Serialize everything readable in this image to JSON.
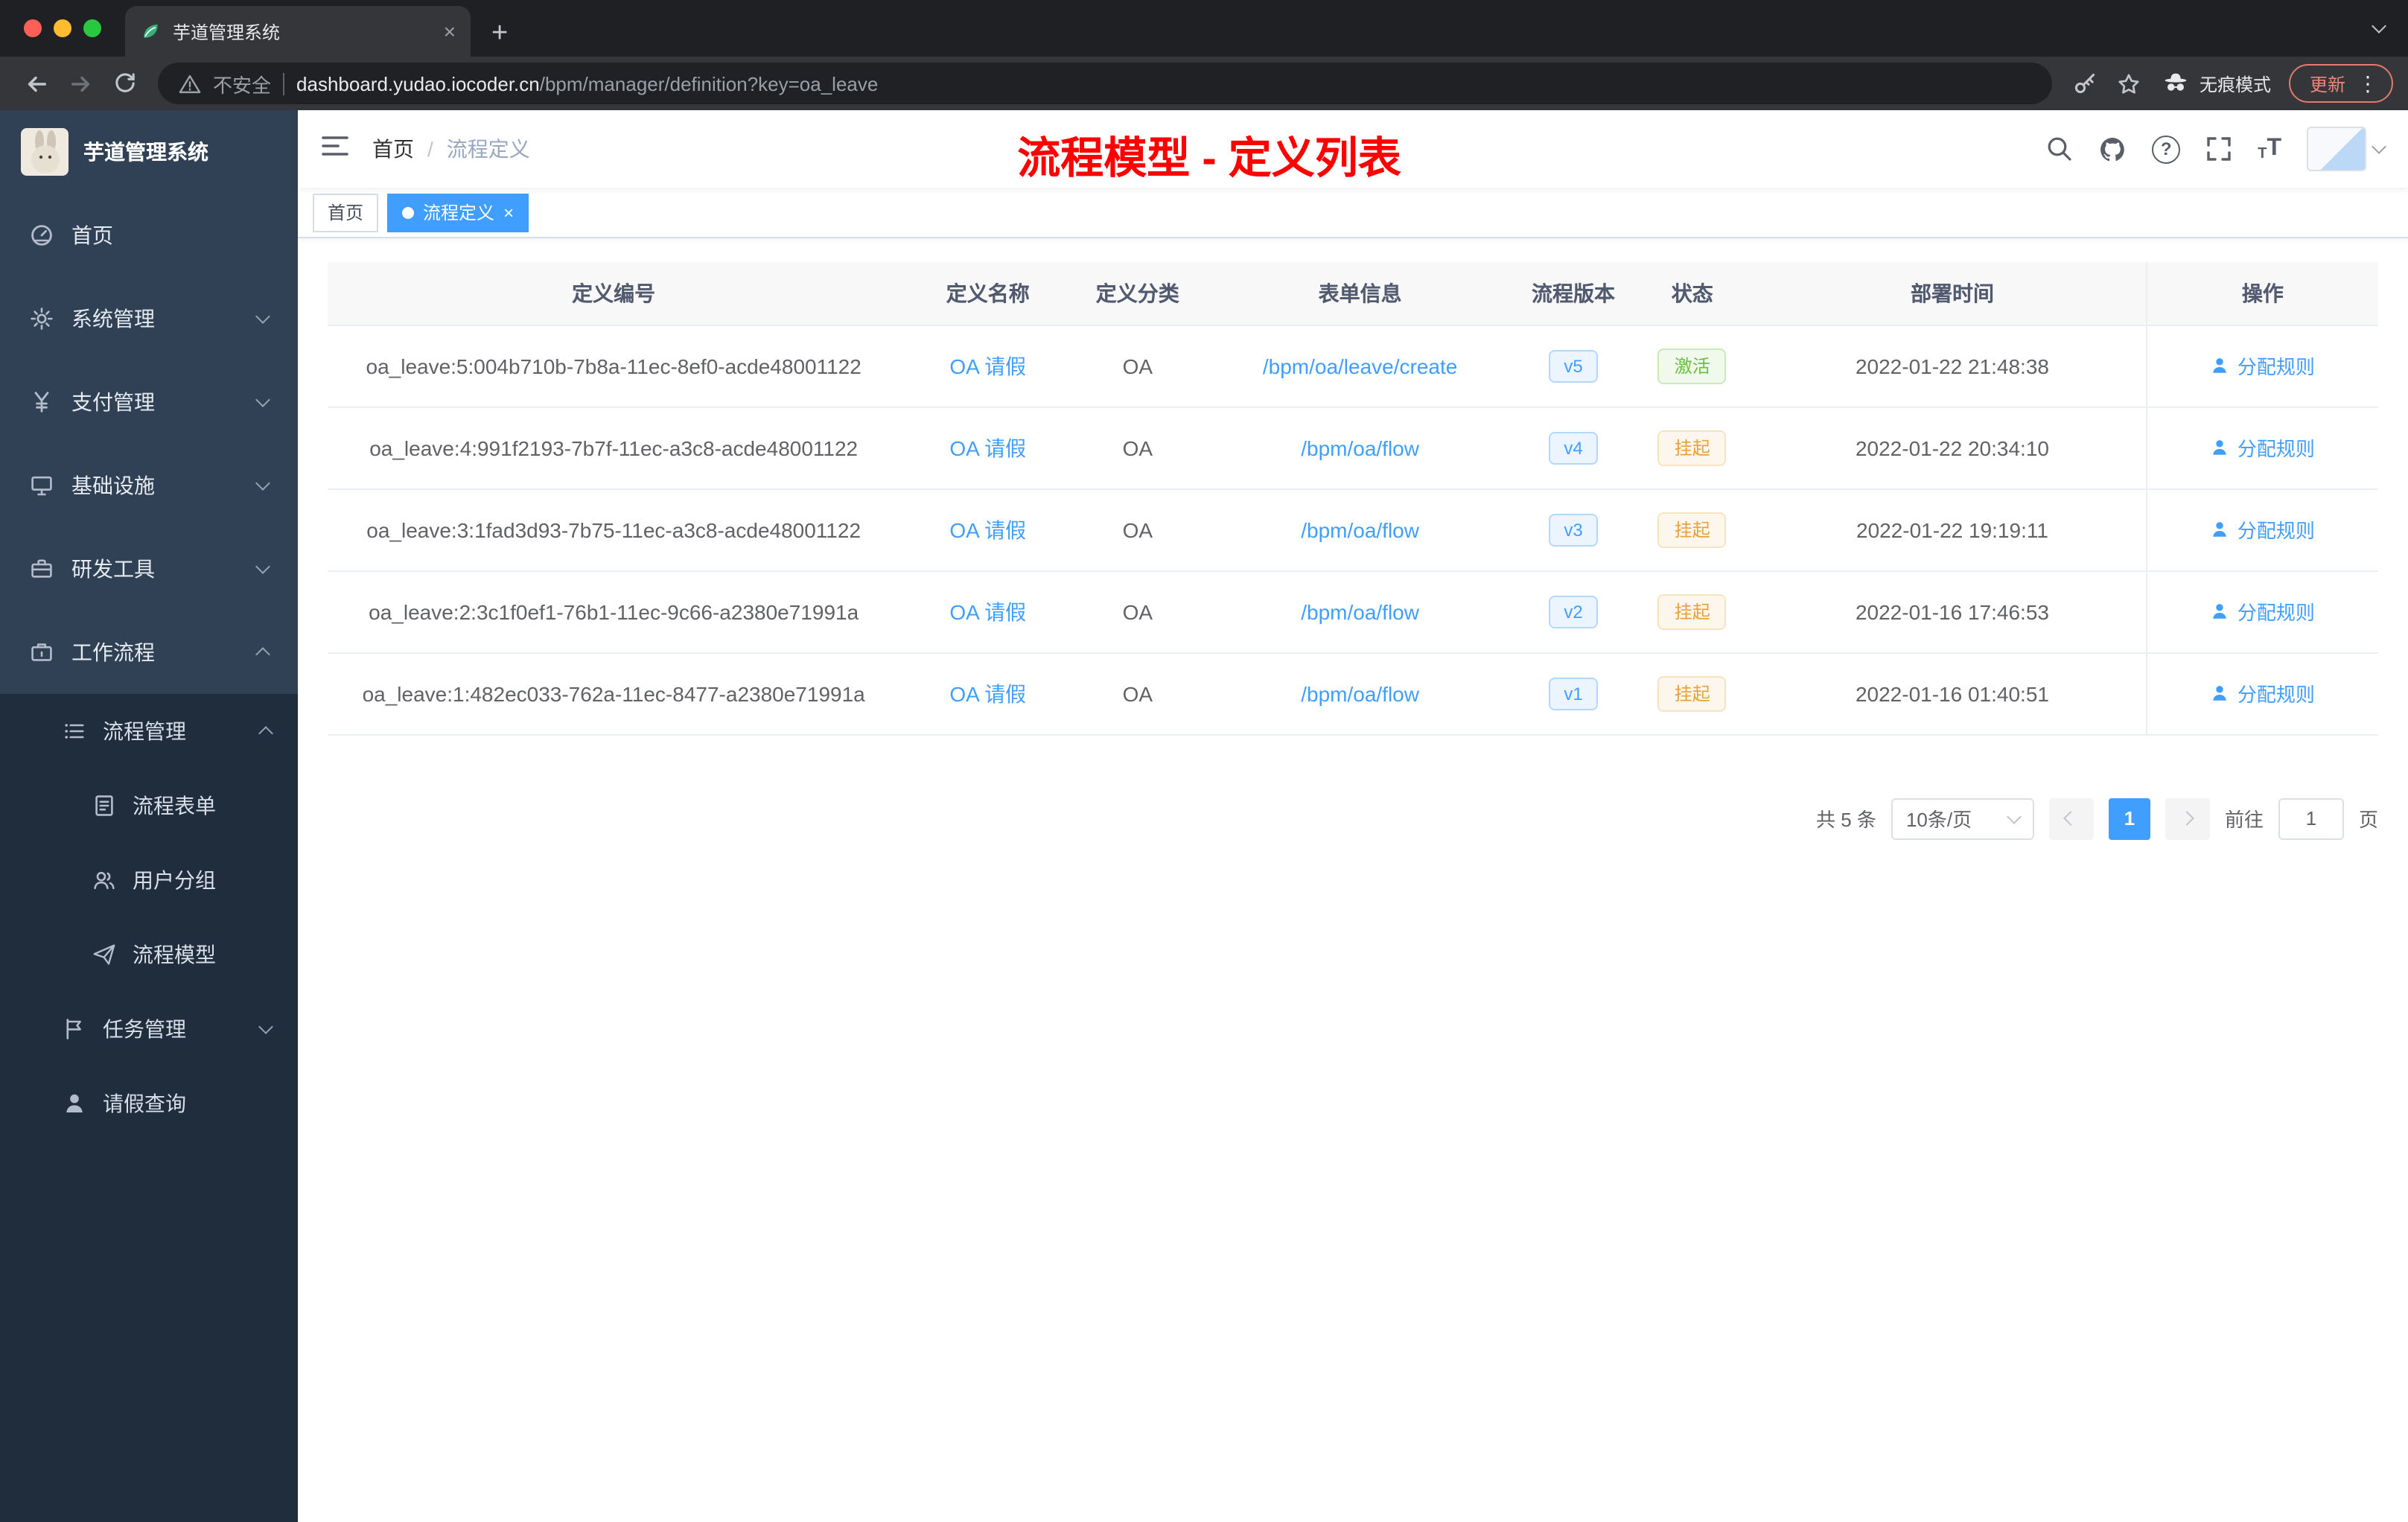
{
  "colors": {
    "accent_blue": "#409eff",
    "annotation_red": "#ff0000",
    "status_active_green": "#67c23a",
    "status_suspended_orange": "#e6a23c",
    "sidebar_bg": "#304156",
    "sidebar_sub_bg": "#1f2d3d",
    "tab_active_bg": "#409eff"
  },
  "glyphs": {
    "close": "×",
    "new_tab": "+",
    "menu_dots": "⋮",
    "help": "?",
    "text_small": "T",
    "text_large": "T"
  },
  "browser": {
    "tab_title": "芋道管理系统",
    "security_label": "不安全",
    "url_host": "dashboard.yudao.iocoder.cn",
    "url_path": "/bpm/manager/definition?key=oa_leave",
    "incognito_label": "无痕模式",
    "update_label": "更新"
  },
  "sidebar": {
    "logo_title": "芋道管理系统",
    "items": [
      {
        "label": "首页"
      },
      {
        "label": "系统管理"
      },
      {
        "label": "支付管理"
      },
      {
        "label": "基础设施"
      },
      {
        "label": "研发工具"
      },
      {
        "label": "工作流程"
      }
    ],
    "submenu": {
      "process_mgmt": "流程管理",
      "children": [
        {
          "label": "流程表单"
        },
        {
          "label": "用户分组"
        },
        {
          "label": "流程模型"
        }
      ],
      "task_mgmt": "任务管理",
      "leave_query": "请假查询"
    }
  },
  "navbar": {
    "breadcrumb_home": "首页",
    "breadcrumb_sep": "/",
    "breadcrumb_current": "流程定义",
    "annotation_title": "流程模型 - 定义列表"
  },
  "tags": [
    {
      "label": "首页"
    },
    {
      "label": "流程定义"
    }
  ],
  "table": {
    "columns": [
      "定义编号",
      "定义名称",
      "定义分类",
      "表单信息",
      "流程版本",
      "状态",
      "部署时间",
      "操作"
    ],
    "rows": [
      {
        "id": "oa_leave:5:004b710b-7b8a-11ec-8ef0-acde48001122",
        "name": "OA 请假",
        "category": "OA",
        "form": "/bpm/oa/leave/create",
        "version": "v5",
        "status": "激活",
        "time": "2022-01-22 21:48:38",
        "action": "分配规则"
      },
      {
        "id": "oa_leave:4:991f2193-7b7f-11ec-a3c8-acde48001122",
        "name": "OA 请假",
        "category": "OA",
        "form": "/bpm/oa/flow",
        "version": "v4",
        "status": "挂起",
        "time": "2022-01-22 20:34:10",
        "action": "分配规则"
      },
      {
        "id": "oa_leave:3:1fad3d93-7b75-11ec-a3c8-acde48001122",
        "name": "OA 请假",
        "category": "OA",
        "form": "/bpm/oa/flow",
        "version": "v3",
        "status": "挂起",
        "time": "2022-01-22 19:19:11",
        "action": "分配规则"
      },
      {
        "id": "oa_leave:2:3c1f0ef1-76b1-11ec-9c66-a2380e71991a",
        "name": "OA 请假",
        "category": "OA",
        "form": "/bpm/oa/flow",
        "version": "v2",
        "status": "挂起",
        "time": "2022-01-16 17:46:53",
        "action": "分配规则"
      },
      {
        "id": "oa_leave:1:482ec033-762a-11ec-8477-a2380e71991a",
        "name": "OA 请假",
        "category": "OA",
        "form": "/bpm/oa/flow",
        "version": "v1",
        "status": "挂起",
        "time": "2022-01-16 01:40:51",
        "action": "分配规则"
      }
    ]
  },
  "pagination": {
    "total": "共 5 条",
    "page_size": "10条/页",
    "current_page": "1",
    "goto_label": "前往",
    "goto_value": "1",
    "page_unit": "页"
  }
}
